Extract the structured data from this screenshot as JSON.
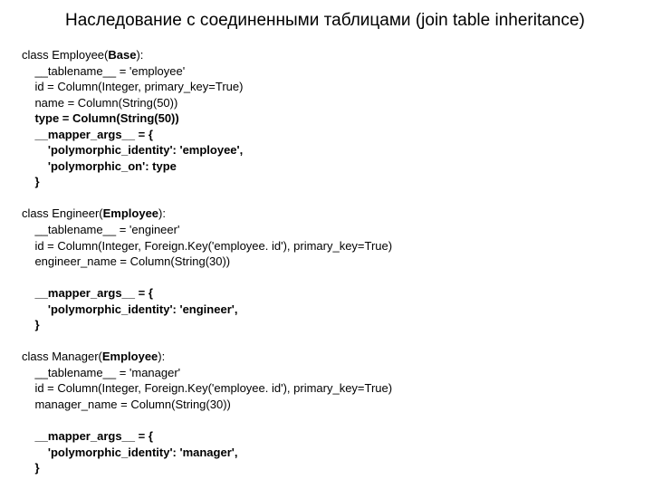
{
  "title": "Наследование с соединенными таблицами (join table inheritance)",
  "code": {
    "emp": {
      "l1a": "class Employee(",
      "l1b": "Base",
      "l1c": "):",
      "l2": "    __tablename__ = 'employee'",
      "l3": "    id = Column(Integer, primary_key=True)",
      "l4": "    name = Column(String(50))",
      "l5": "    type = Column(String(50))",
      "l6": "    __mapper_args__ = {",
      "l7": "        'polymorphic_identity': 'employee',",
      "l8": "        'polymorphic_on': type",
      "l9": "    }"
    },
    "eng": {
      "l1a": "class Engineer(",
      "l1b": "Employee",
      "l1c": "):",
      "l2": "    __tablename__ = 'engineer'",
      "l3": "    id = Column(Integer, Foreign.Key('employee. id'), primary_key=True)",
      "l4": "    engineer_name = Column(String(30))",
      "l5": "",
      "l6": "    __mapper_args__ = {",
      "l7": "        'polymorphic_identity': 'engineer',",
      "l8": "    }"
    },
    "mgr": {
      "l1a": "class Manager(",
      "l1b": "Employee",
      "l1c": "):",
      "l2": "    __tablename__ = 'manager'",
      "l3": "    id = Column(Integer, Foreign.Key('employee. id'), primary_key=True)",
      "l4": "    manager_name = Column(String(30))",
      "l5": "",
      "l6": "    __mapper_args__ = {",
      "l7": "        'polymorphic_identity': 'manager',",
      "l8": "    }"
    }
  }
}
